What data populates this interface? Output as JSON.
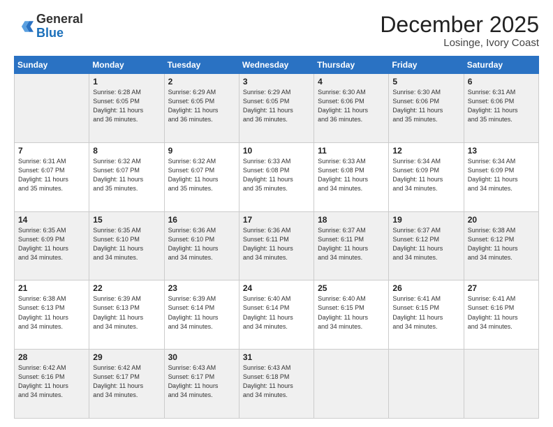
{
  "header": {
    "logo_general": "General",
    "logo_blue": "Blue",
    "month": "December 2025",
    "location": "Losinge, Ivory Coast"
  },
  "days_header": [
    "Sunday",
    "Monday",
    "Tuesday",
    "Wednesday",
    "Thursday",
    "Friday",
    "Saturday"
  ],
  "weeks": [
    [
      {
        "day": "",
        "info": ""
      },
      {
        "day": "1",
        "info": "Sunrise: 6:28 AM\nSunset: 6:05 PM\nDaylight: 11 hours\nand 36 minutes."
      },
      {
        "day": "2",
        "info": "Sunrise: 6:29 AM\nSunset: 6:05 PM\nDaylight: 11 hours\nand 36 minutes."
      },
      {
        "day": "3",
        "info": "Sunrise: 6:29 AM\nSunset: 6:05 PM\nDaylight: 11 hours\nand 36 minutes."
      },
      {
        "day": "4",
        "info": "Sunrise: 6:30 AM\nSunset: 6:06 PM\nDaylight: 11 hours\nand 36 minutes."
      },
      {
        "day": "5",
        "info": "Sunrise: 6:30 AM\nSunset: 6:06 PM\nDaylight: 11 hours\nand 35 minutes."
      },
      {
        "day": "6",
        "info": "Sunrise: 6:31 AM\nSunset: 6:06 PM\nDaylight: 11 hours\nand 35 minutes."
      }
    ],
    [
      {
        "day": "7",
        "info": "Sunrise: 6:31 AM\nSunset: 6:07 PM\nDaylight: 11 hours\nand 35 minutes."
      },
      {
        "day": "8",
        "info": "Sunrise: 6:32 AM\nSunset: 6:07 PM\nDaylight: 11 hours\nand 35 minutes."
      },
      {
        "day": "9",
        "info": "Sunrise: 6:32 AM\nSunset: 6:07 PM\nDaylight: 11 hours\nand 35 minutes."
      },
      {
        "day": "10",
        "info": "Sunrise: 6:33 AM\nSunset: 6:08 PM\nDaylight: 11 hours\nand 35 minutes."
      },
      {
        "day": "11",
        "info": "Sunrise: 6:33 AM\nSunset: 6:08 PM\nDaylight: 11 hours\nand 34 minutes."
      },
      {
        "day": "12",
        "info": "Sunrise: 6:34 AM\nSunset: 6:09 PM\nDaylight: 11 hours\nand 34 minutes."
      },
      {
        "day": "13",
        "info": "Sunrise: 6:34 AM\nSunset: 6:09 PM\nDaylight: 11 hours\nand 34 minutes."
      }
    ],
    [
      {
        "day": "14",
        "info": "Sunrise: 6:35 AM\nSunset: 6:09 PM\nDaylight: 11 hours\nand 34 minutes."
      },
      {
        "day": "15",
        "info": "Sunrise: 6:35 AM\nSunset: 6:10 PM\nDaylight: 11 hours\nand 34 minutes."
      },
      {
        "day": "16",
        "info": "Sunrise: 6:36 AM\nSunset: 6:10 PM\nDaylight: 11 hours\nand 34 minutes."
      },
      {
        "day": "17",
        "info": "Sunrise: 6:36 AM\nSunset: 6:11 PM\nDaylight: 11 hours\nand 34 minutes."
      },
      {
        "day": "18",
        "info": "Sunrise: 6:37 AM\nSunset: 6:11 PM\nDaylight: 11 hours\nand 34 minutes."
      },
      {
        "day": "19",
        "info": "Sunrise: 6:37 AM\nSunset: 6:12 PM\nDaylight: 11 hours\nand 34 minutes."
      },
      {
        "day": "20",
        "info": "Sunrise: 6:38 AM\nSunset: 6:12 PM\nDaylight: 11 hours\nand 34 minutes."
      }
    ],
    [
      {
        "day": "21",
        "info": "Sunrise: 6:38 AM\nSunset: 6:13 PM\nDaylight: 11 hours\nand 34 minutes."
      },
      {
        "day": "22",
        "info": "Sunrise: 6:39 AM\nSunset: 6:13 PM\nDaylight: 11 hours\nand 34 minutes."
      },
      {
        "day": "23",
        "info": "Sunrise: 6:39 AM\nSunset: 6:14 PM\nDaylight: 11 hours\nand 34 minutes."
      },
      {
        "day": "24",
        "info": "Sunrise: 6:40 AM\nSunset: 6:14 PM\nDaylight: 11 hours\nand 34 minutes."
      },
      {
        "day": "25",
        "info": "Sunrise: 6:40 AM\nSunset: 6:15 PM\nDaylight: 11 hours\nand 34 minutes."
      },
      {
        "day": "26",
        "info": "Sunrise: 6:41 AM\nSunset: 6:15 PM\nDaylight: 11 hours\nand 34 minutes."
      },
      {
        "day": "27",
        "info": "Sunrise: 6:41 AM\nSunset: 6:16 PM\nDaylight: 11 hours\nand 34 minutes."
      }
    ],
    [
      {
        "day": "28",
        "info": "Sunrise: 6:42 AM\nSunset: 6:16 PM\nDaylight: 11 hours\nand 34 minutes."
      },
      {
        "day": "29",
        "info": "Sunrise: 6:42 AM\nSunset: 6:17 PM\nDaylight: 11 hours\nand 34 minutes."
      },
      {
        "day": "30",
        "info": "Sunrise: 6:43 AM\nSunset: 6:17 PM\nDaylight: 11 hours\nand 34 minutes."
      },
      {
        "day": "31",
        "info": "Sunrise: 6:43 AM\nSunset: 6:18 PM\nDaylight: 11 hours\nand 34 minutes."
      },
      {
        "day": "",
        "info": ""
      },
      {
        "day": "",
        "info": ""
      },
      {
        "day": "",
        "info": ""
      }
    ]
  ]
}
